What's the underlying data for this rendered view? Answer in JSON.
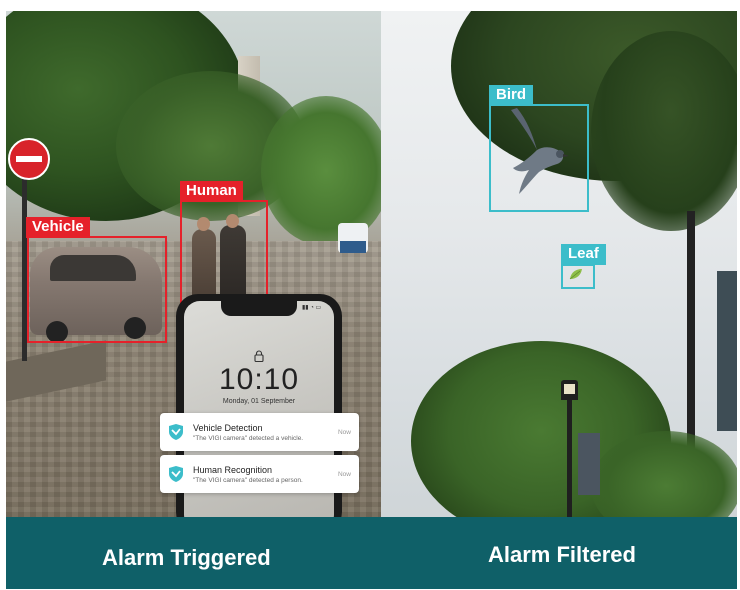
{
  "left_panel": {
    "vehicle_label": "Vehicle",
    "human_label": "Human",
    "caption": "Alarm Triggered",
    "detection_color": "#e5212a",
    "phone": {
      "time": "10:10",
      "date": "Monday, 01 September",
      "notifications": [
        {
          "title": "Vehicle Detection",
          "body": "\"The VIGI camera\" detected a vehicle.",
          "time": "Now",
          "icon": "vigi-shield-icon"
        },
        {
          "title": "Human Recognition",
          "body": "\"The VIGI camera\" detected a person.",
          "time": "Now",
          "icon": "vigi-shield-icon"
        }
      ]
    }
  },
  "right_panel": {
    "bird_label": "Bird",
    "leaf_label": "Leaf",
    "caption": "Alarm Filtered",
    "detection_color": "#3cbdca"
  },
  "theme": {
    "bar_color": "#0f6068",
    "caption_color": "#ffffff"
  }
}
